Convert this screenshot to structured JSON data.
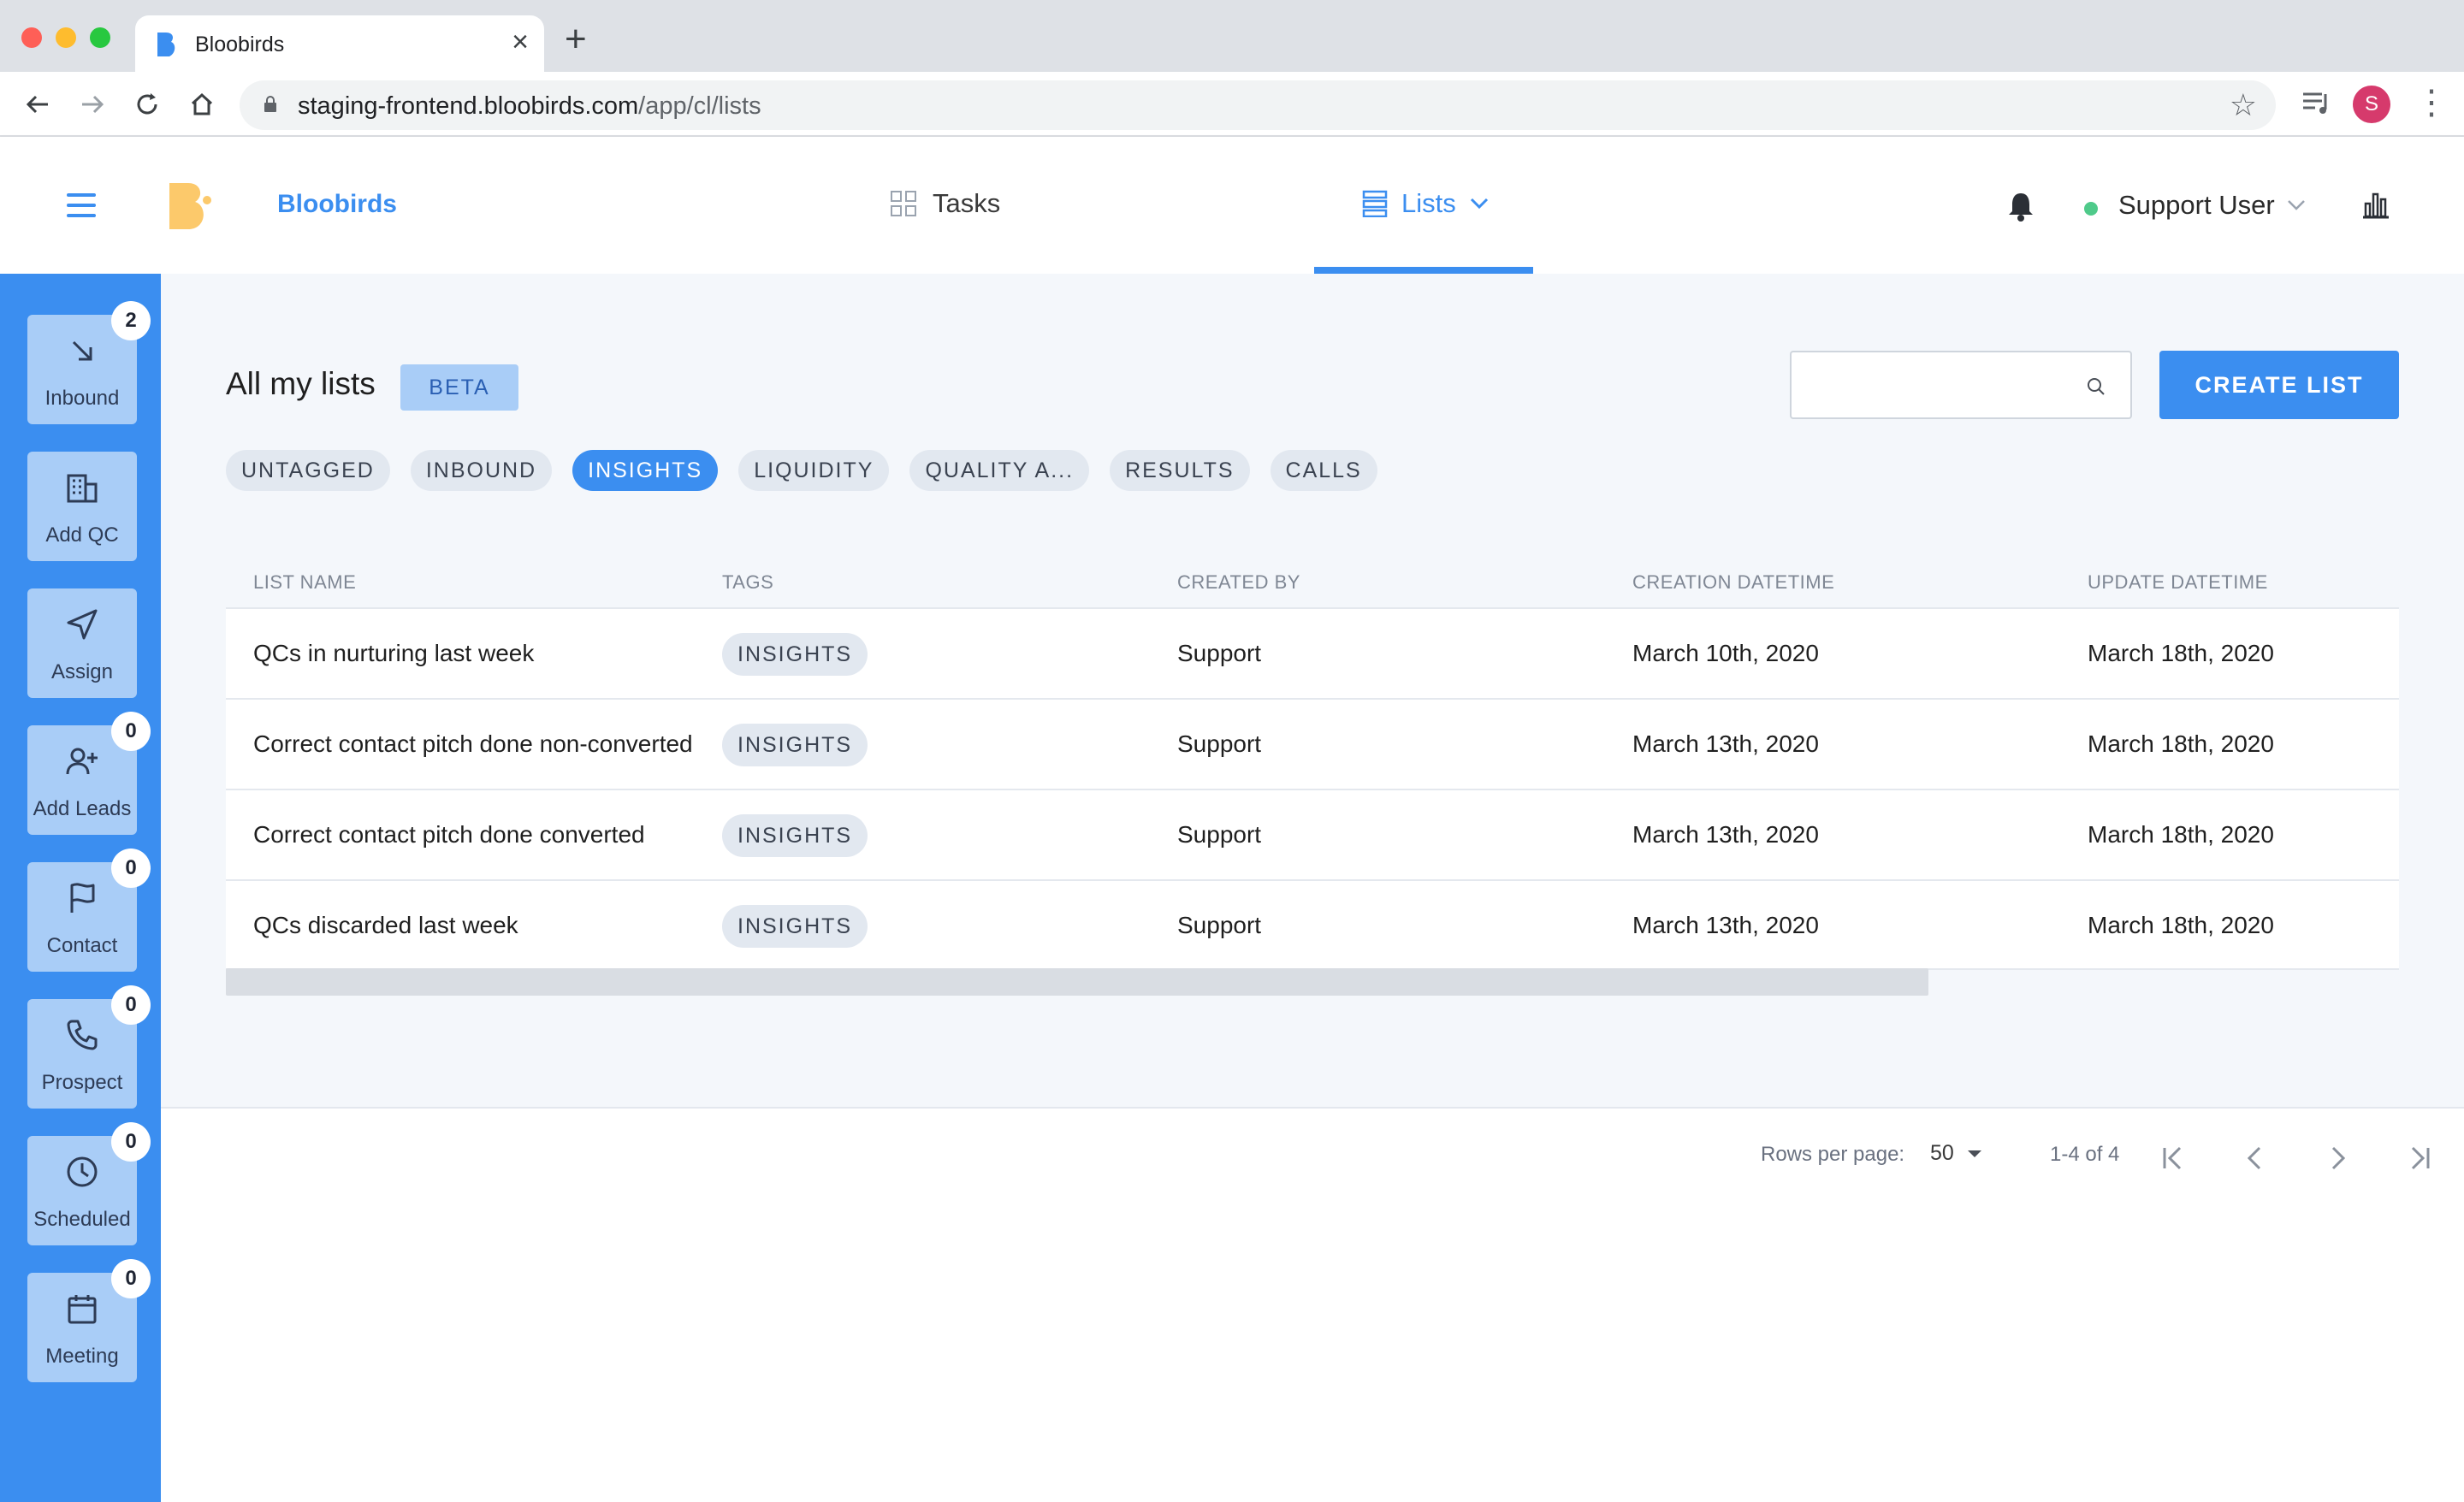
{
  "browser": {
    "tab_title": "Bloobirds",
    "new_tab": "+",
    "close": "×",
    "url_host": "staging-frontend.bloobirds.com",
    "url_path": "/app/cl/lists",
    "profile_initial": "S"
  },
  "header": {
    "brand": "Bloobirds",
    "nav": {
      "tasks": "Tasks",
      "lists": "Lists"
    },
    "user": "Support User"
  },
  "sidebar": {
    "items": [
      {
        "label": "Inbound",
        "badge": "2",
        "icon": "arrow-down-right-icon"
      },
      {
        "label": "Add QC",
        "badge": "",
        "icon": "building-icon"
      },
      {
        "label": "Assign",
        "badge": "",
        "icon": "send-icon"
      },
      {
        "label": "Add Leads",
        "badge": "0",
        "icon": "user-plus-icon"
      },
      {
        "label": "Contact",
        "badge": "0",
        "icon": "flag-icon"
      },
      {
        "label": "Prospect",
        "badge": "0",
        "icon": "phone-icon"
      },
      {
        "label": "Scheduled",
        "badge": "0",
        "icon": "clock-icon"
      },
      {
        "label": "Meeting",
        "badge": "0",
        "icon": "calendar-icon"
      }
    ]
  },
  "main": {
    "title": "All my lists",
    "beta": "BETA",
    "search_placeholder": "",
    "create_button": "CREATE LIST",
    "filters": [
      "UNTAGGED",
      "INBOUND",
      "INSIGHTS",
      "LIQUIDITY",
      "QUALITY A...",
      "RESULTS",
      "CALLS"
    ],
    "active_filter": "INSIGHTS",
    "table": {
      "columns": [
        "LIST NAME",
        "TAGS",
        "CREATED BY",
        "CREATION DATETIME",
        "UPDATE DATETIME"
      ],
      "rows": [
        [
          "QCs in nurturing last week",
          "INSIGHTS",
          "Support",
          "March 10th, 2020",
          "March 18th, 2020"
        ],
        [
          "Correct contact pitch done non-converted",
          "INSIGHTS",
          "Support",
          "March 13th, 2020",
          "March 18th, 2020"
        ],
        [
          "Correct contact pitch done converted",
          "INSIGHTS",
          "Support",
          "March 13th, 2020",
          "March 18th, 2020"
        ],
        [
          "QCs discarded last week",
          "INSIGHTS",
          "Support",
          "March 13th, 2020",
          "March 18th, 2020"
        ]
      ]
    }
  },
  "pagination": {
    "rows_per_page_label": "Rows per page:",
    "rows_per_page": "50",
    "range": "1-4 of 4"
  },
  "colors": {
    "accent": "#3b8ef0",
    "sidebar_tile": "#a9cdf7",
    "status_online": "#4fca8a"
  }
}
